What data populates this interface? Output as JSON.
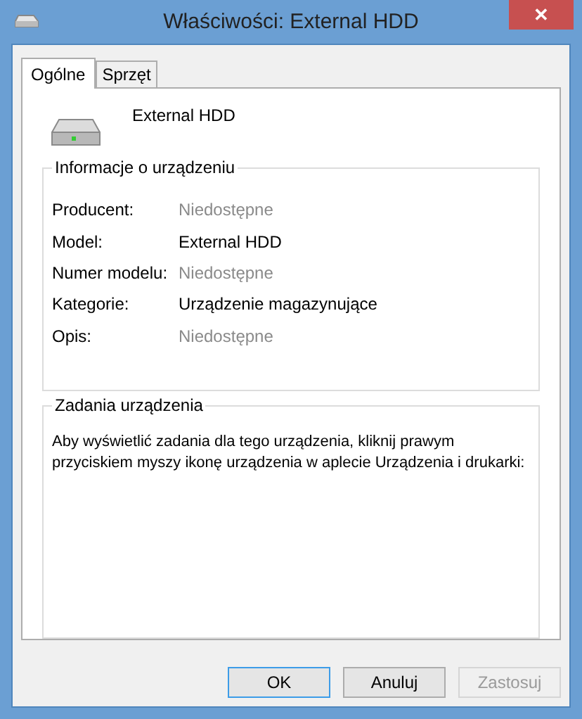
{
  "window": {
    "title": "Właściwości: External HDD",
    "close": "✕"
  },
  "tabs": [
    {
      "label": "Ogólne",
      "selected": true
    },
    {
      "label": "Sprzęt",
      "selected": false
    }
  ],
  "device": {
    "name": "External HDD"
  },
  "device_info": {
    "title": "Informacje o urządzeniu",
    "rows": [
      {
        "label": "Producent:",
        "value": "Niedostępne",
        "disabled": true
      },
      {
        "label": "Model:",
        "value": "External HDD",
        "disabled": false
      },
      {
        "label": "Numer modelu:",
        "value": "Niedostępne",
        "disabled": true
      },
      {
        "label": "Kategorie:",
        "value": "Urządzenie magazynujące",
        "disabled": false
      },
      {
        "label": "Opis:",
        "value": "Niedostępne",
        "disabled": true
      }
    ]
  },
  "device_tasks": {
    "title": "Zadania urządzenia",
    "text": "Aby wyświetlić zadania dla tego urządzenia, kliknij prawym przyciskiem myszy ikonę urządzenia w aplecie Urządzenia i drukarki:"
  },
  "buttons": [
    {
      "label": "OK",
      "default": true,
      "disabled": false
    },
    {
      "label": "Anuluj",
      "default": false,
      "disabled": false
    },
    {
      "label": "Zastosuj",
      "default": false,
      "disabled": true
    }
  ]
}
